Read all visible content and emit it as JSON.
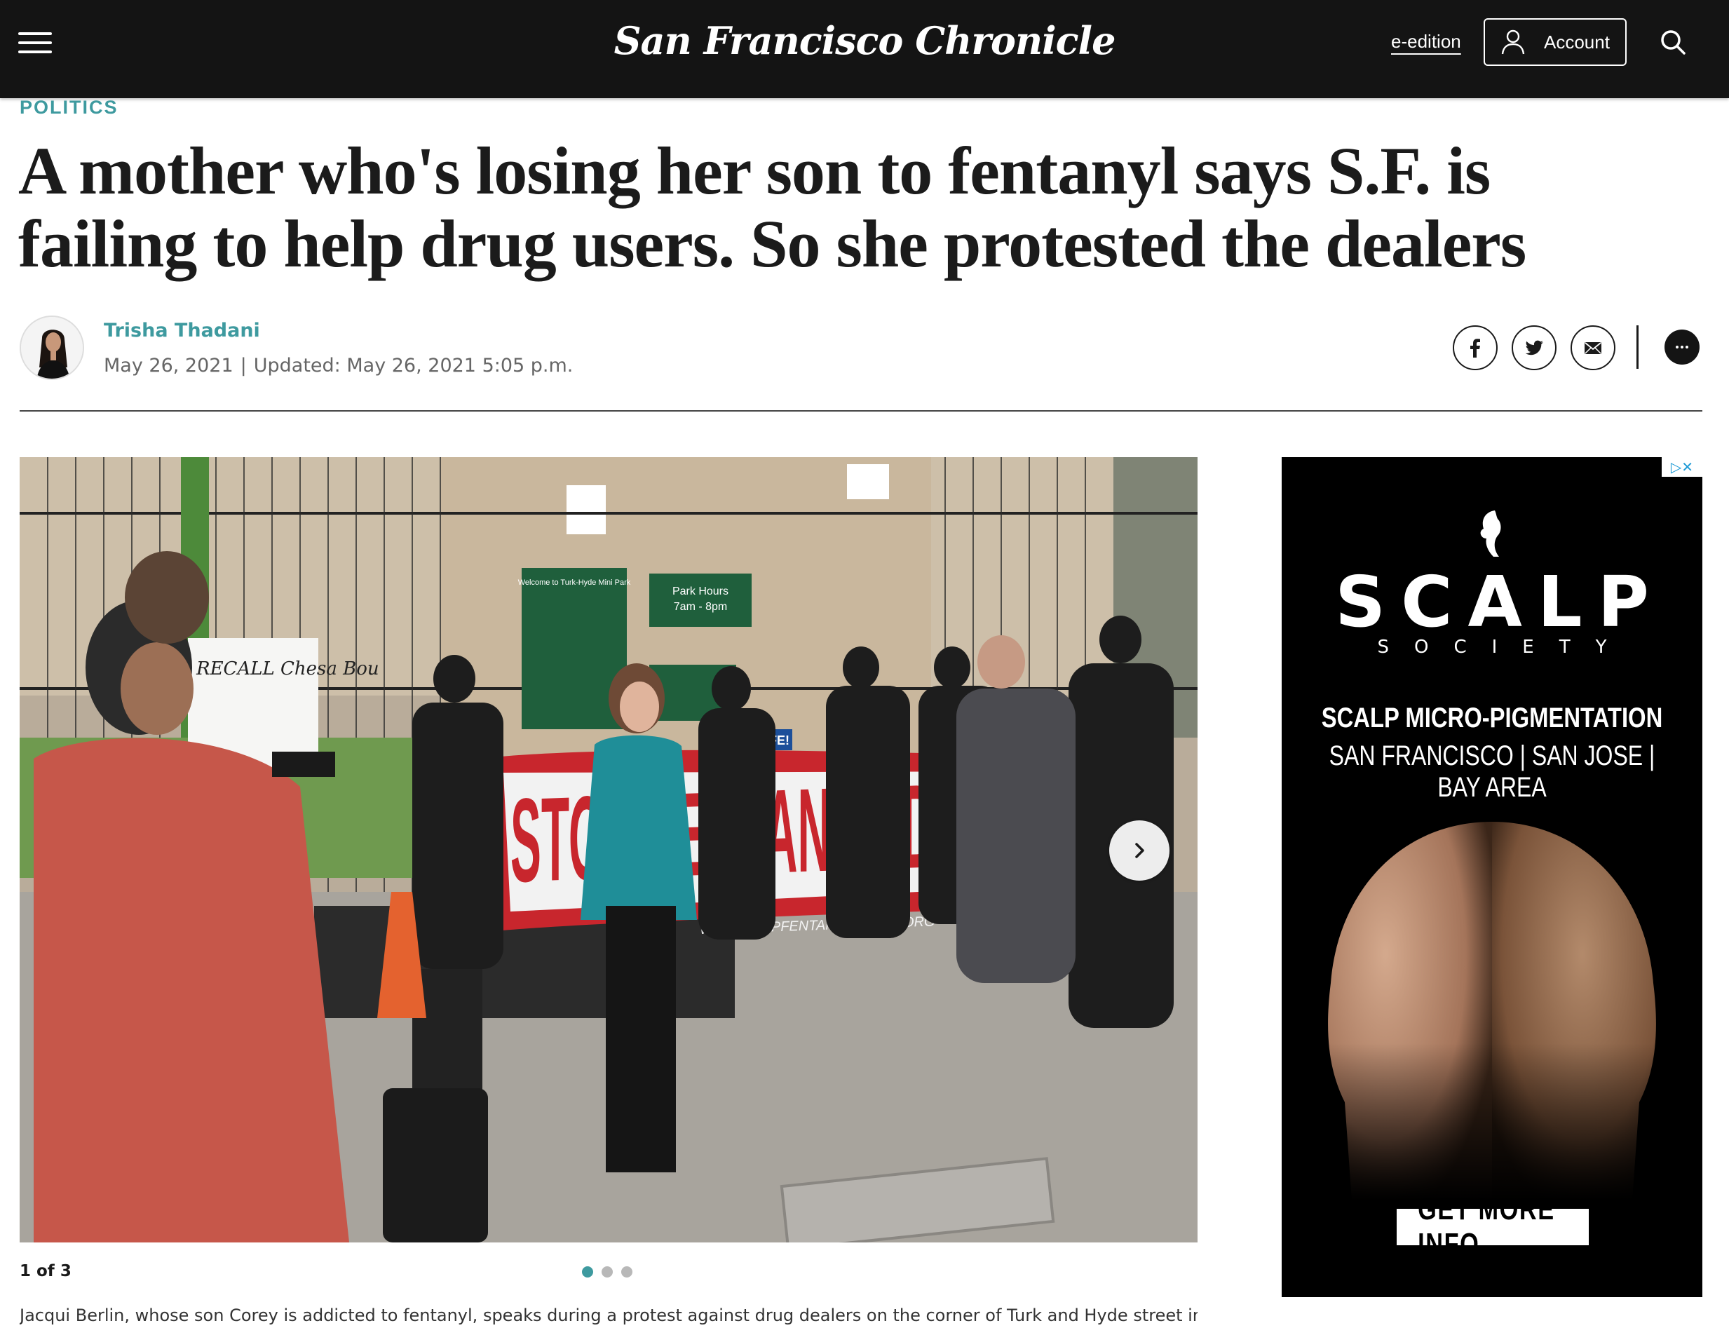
{
  "header": {
    "logo": "San Francisco Chronicle",
    "eedition_label": "e-edition",
    "account_label": "Account",
    "icons": [
      "menu-icon",
      "user-icon",
      "search-icon"
    ]
  },
  "article": {
    "section": "POLITICS",
    "headline_line1": "A mother who's losing her son to fentanyl says S.F. is",
    "headline_line2": "failing to help drug users. So she protested the dealers",
    "author": "Trisha Thadani",
    "published": "May 26, 2021",
    "separator": "|",
    "updated": "Updated: May 26, 2021 5:05 p.m.",
    "share_icons": [
      "facebook-icon",
      "twitter-icon",
      "email-icon",
      "comment-icon"
    ]
  },
  "gallery": {
    "counter": "1 of 3",
    "total": 3,
    "active_index": 0,
    "caption": "Jacqui Berlin, whose son Corey is addicted to fentanyl, speaks during a protest against drug dealers on the corner of Turk and Hyde street in the",
    "photo_texts": {
      "banner": "STOP FENTANYL DEATH",
      "banner_url": "WWW.STOPFENTANYLDEATH.ORG",
      "sign_welcome": "Welcome to Turk-Hyde Mini Park",
      "sign_hours_title": "Park Hours",
      "sign_hours": "7am - 8pm",
      "sign_safe": "SAFE!",
      "placard": "RECALL Chesa Bou"
    }
  },
  "ad": {
    "brand": "SCALP",
    "brand_sub": "SOCIETY",
    "headline": "SCALP MICRO-PIGMENTATION",
    "locations": "SAN FRANCISCO | SAN JOSE | BAY AREA",
    "cta": "GET MORE INFO",
    "choices_label": "▷✕"
  },
  "colors": {
    "accent": "#3e9a9f",
    "header_bg": "#141414",
    "banner_red": "#c8262d"
  }
}
